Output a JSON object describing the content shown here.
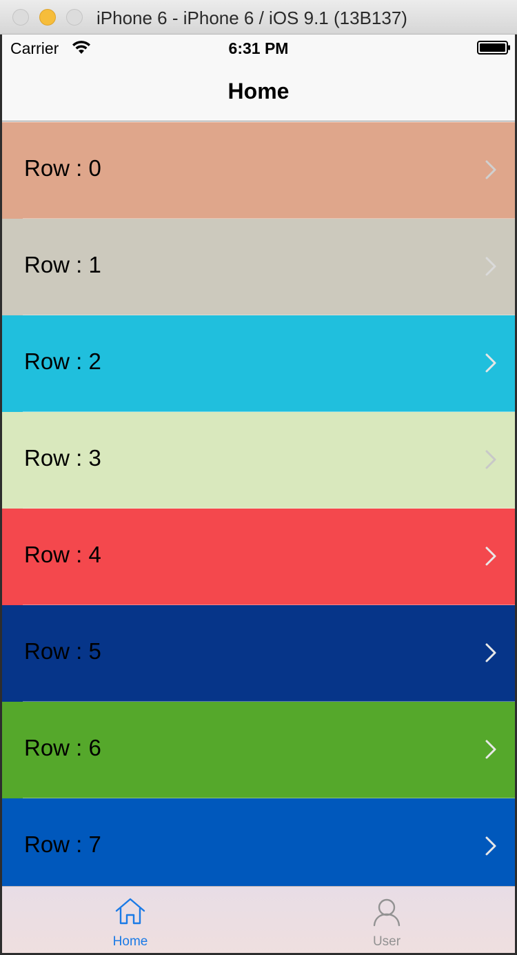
{
  "window": {
    "title": "iPhone 6 - iPhone 6 / iOS 9.1 (13B137)"
  },
  "status_bar": {
    "carrier": "Carrier",
    "time": "6:31 PM",
    "icons": [
      "wifi-icon",
      "battery-icon"
    ]
  },
  "nav": {
    "title": "Home"
  },
  "rows": [
    {
      "label": "Row : 0",
      "color": "#dfa68b",
      "chevron_color": "#d0d0d0"
    },
    {
      "label": "Row : 1",
      "color": "#ccc9bd",
      "chevron_color": "#dadada"
    },
    {
      "label": "Row : 2",
      "color": "#20bfdd",
      "chevron_color": "#e6e6e6"
    },
    {
      "label": "Row : 3",
      "color": "#d9e8bd",
      "chevron_color": "#c8c8c8"
    },
    {
      "label": "Row : 4",
      "color": "#f4484d",
      "chevron_color": "#e8e8e8"
    },
    {
      "label": "Row : 5",
      "color": "#063589",
      "chevron_color": "#e8e8e8"
    },
    {
      "label": "Row : 6",
      "color": "#55a82b",
      "chevron_color": "#e8e8e8"
    },
    {
      "label": "Row : 7",
      "color": "#0058bc",
      "chevron_color": "#e8e8e8"
    }
  ],
  "tab_bar": {
    "tabs": [
      {
        "label": "Home",
        "icon": "home-icon",
        "selected": true,
        "color": "#1a7ae6"
      },
      {
        "label": "User",
        "icon": "user-icon",
        "selected": false,
        "color": "#929292"
      }
    ]
  }
}
